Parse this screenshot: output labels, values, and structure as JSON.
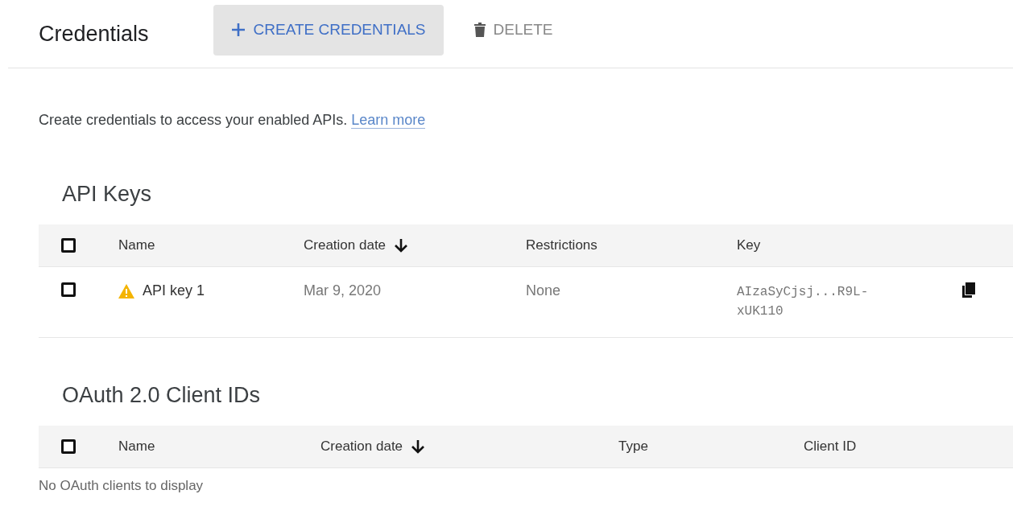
{
  "header": {
    "title": "Credentials",
    "actions": [
      {
        "kind": "create",
        "label": "CREATE CREDENTIALS"
      },
      {
        "kind": "delete",
        "label": "DELETE"
      }
    ]
  },
  "intro": {
    "text": "Create credentials to access your enabled APIs.",
    "link": "Learn more"
  },
  "api_keys": {
    "heading": "API Keys",
    "select_all_checked": false,
    "columns": [
      {
        "label": "Name",
        "sorted": false
      },
      {
        "label": "Creation date",
        "sorted": true
      },
      {
        "label": "Restrictions",
        "sorted": false
      },
      {
        "label": "Key",
        "sorted": false
      }
    ],
    "rows": [
      {
        "checked": false,
        "warning": true,
        "name": "API key 1",
        "created": "Mar 9, 2020",
        "restrictions": "None",
        "key": "AIzaSyCjsj...R9L-xUK110"
      }
    ]
  },
  "oauth": {
    "heading": "OAuth 2.0 Client IDs",
    "select_all_checked": false,
    "columns": [
      {
        "label": "Name",
        "sorted": false
      },
      {
        "label": "Creation date",
        "sorted": true
      },
      {
        "label": "Type",
        "sorted": false
      },
      {
        "label": "Client ID",
        "sorted": false
      }
    ],
    "empty": "No OAuth clients to display"
  }
}
